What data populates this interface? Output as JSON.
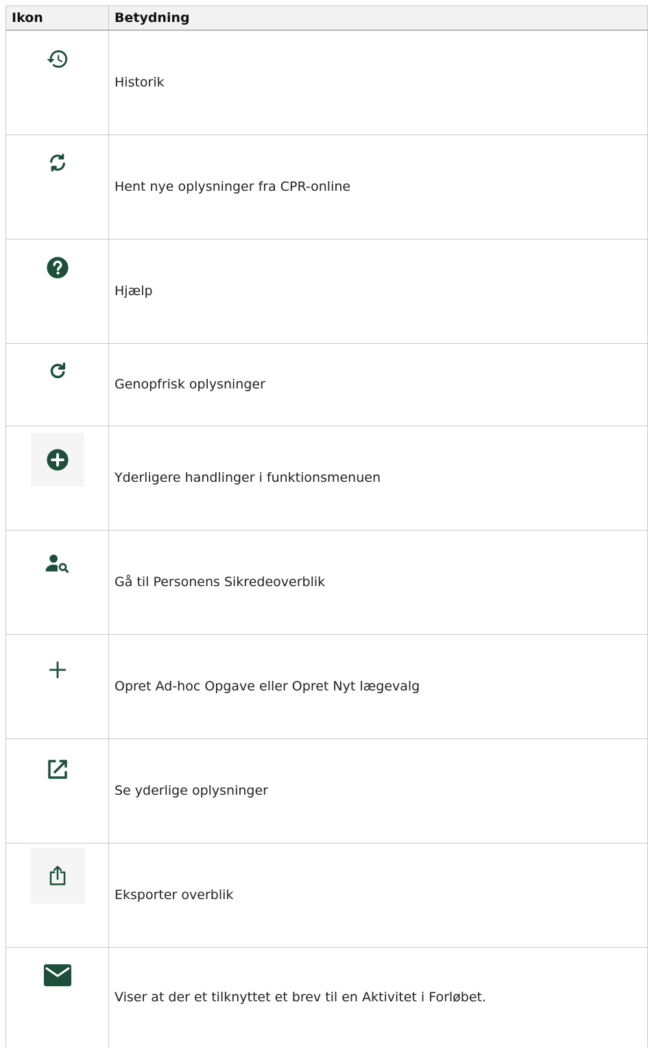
{
  "table": {
    "headers": {
      "icon": "Ikon",
      "meaning": "Betydning"
    },
    "rows": [
      {
        "icon": "history-icon",
        "meaning": "Historik"
      },
      {
        "icon": "sync-icon",
        "meaning": "Hent nye oplysninger fra CPR-online"
      },
      {
        "icon": "help-icon",
        "meaning": "Hjælp"
      },
      {
        "icon": "refresh-icon",
        "meaning": "Genopfrisk oplysninger"
      },
      {
        "icon": "add-circle-icon",
        "meaning": "Yderligere handlinger i funktionsmenuen"
      },
      {
        "icon": "person-search-icon",
        "meaning": "Gå til Personens Sikredeoverblik"
      },
      {
        "icon": "plus-icon",
        "meaning": "Opret Ad-hoc Opgave eller Opret Nyt lægevalg"
      },
      {
        "icon": "open-in-new-icon",
        "meaning": "Se yderlige oplysninger"
      },
      {
        "icon": "export-icon",
        "meaning": "Eksporter overblik"
      },
      {
        "icon": "mail-icon",
        "meaning": "Viser at der et tilknyttet et brev til en Aktivitet i Forløbet."
      }
    ]
  },
  "colors": {
    "icon": "#1d4f3b",
    "border": "#c8c8c8",
    "header_bg": "#f2f2f2"
  }
}
